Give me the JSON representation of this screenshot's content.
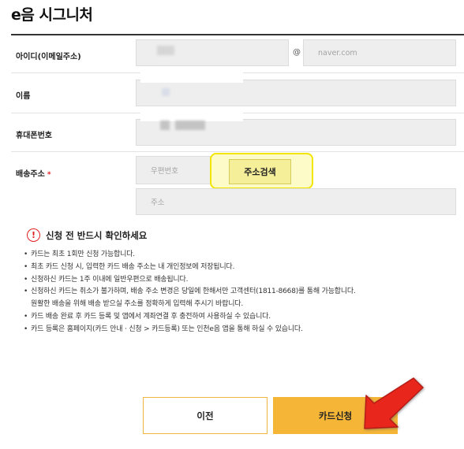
{
  "page": {
    "title": "e음 시그니처"
  },
  "form": {
    "id_label": "아이디(이메일주소)",
    "at": "@",
    "email_domain": "naver.com",
    "name_label": "이름",
    "phone_label": "휴대폰번호",
    "address_label": "배송주소",
    "required_mark": "*",
    "postcode_placeholder": "우편번호",
    "search_button": "주소검색",
    "address_placeholder": "주소"
  },
  "notice": {
    "title": "신청 전 반드시 확인하세요",
    "icon": "!",
    "items": [
      "카드는 최초 1회만 신청 가능합니다.",
      "최초 카드 신청 시, 입력한 카드 배송 주소는 내 개인정보에 저장됩니다.",
      "신청하신 카드는 1주 이내에 일반우편으로 배송됩니다.",
      "신청하신 카드는 취소가 불가하며, 배송 주소 변경은 당일에 한해서만 고객센터(1811-8668)를 통해 가능합니다.",
      "원활한 배송을 위해 배송 받으실 주소를 정확하게 입력해 주시기 바랍니다.",
      "카드 배송 완료 후 카드 등록 및 앱에서 계좌연결 후 충전하여 사용하실 수 있습니다.",
      "카드 등록은 홈페이지(카드 안내 · 신청 > 카드등록) 또는 인천e음 앱을 통해 하실 수 있습니다."
    ]
  },
  "buttons": {
    "prev": "이전",
    "apply": "카드신청"
  },
  "colors": {
    "accent": "#f5b638",
    "highlight": "#f2e600",
    "arrow": "#e8281e",
    "required": "#e02020"
  }
}
